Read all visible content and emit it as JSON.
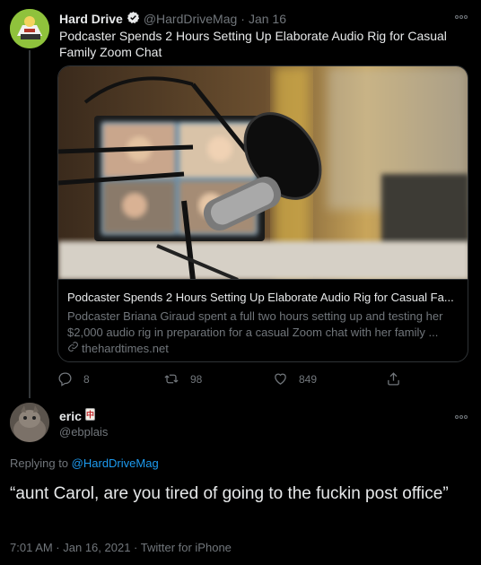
{
  "tweet1": {
    "display_name": "Hard Drive",
    "handle": "@HardDriveMag",
    "separator": "·",
    "date": "Jan 16",
    "text": "Podcaster Spends 2 Hours Setting Up Elaborate Audio Rig for Casual Family Zoom Chat",
    "card": {
      "title": "Podcaster Spends 2 Hours Setting Up Elaborate Audio Rig for Casual Fa...",
      "description_line1": "Podcaster Briana Giraud spent a full two hours setting up and testing her",
      "description_line2": "$2,000 audio rig in preparation for a casual Zoom chat with her family ...",
      "domain": "thehardtimes.net"
    },
    "actions": {
      "replies": "8",
      "retweets": "98",
      "likes": "849"
    }
  },
  "tweet2": {
    "display_name": "eric",
    "handle": "@ebplais",
    "replying_prefix": "Replying to",
    "replying_to": "@HardDriveMag",
    "text": "“aunt Carol, are you tired of going to the fuckin post office”",
    "timestamp": "7:01 AM · Jan 16, 2021 · Twitter for iPhone"
  },
  "icons": {
    "verified": "verified-badge-icon",
    "more": "more-icon",
    "reply": "reply-icon",
    "retweet": "retweet-icon",
    "like": "heart-icon",
    "share": "share-icon",
    "link": "link-icon",
    "emoji": "mahjong-tile-icon"
  },
  "colors": {
    "background": "#000000",
    "link": "#1d9bf0",
    "muted": "#71767b",
    "text": "#e7e9ea"
  }
}
